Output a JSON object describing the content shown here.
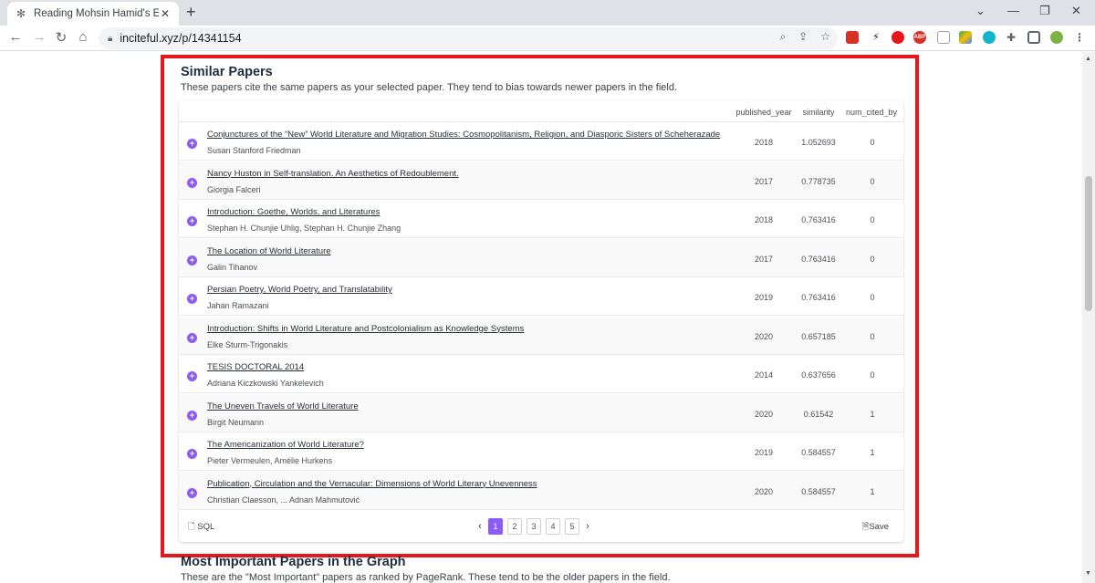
{
  "browser": {
    "tab_title": "Reading Mohsin Hamid's Exit We",
    "tab_close": "✕",
    "new_tab": "+",
    "url": "inciteful.xyz/p/14341154",
    "nav": {
      "back": "←",
      "forward": "→",
      "reload": "↻",
      "home": "⌂"
    },
    "window": {
      "dropdown": "⌄",
      "minimize": "—",
      "restore": "❐",
      "close": "✕"
    }
  },
  "similar": {
    "title": "Similar Papers",
    "description": "These papers cite the same papers as your selected paper. They tend to bias towards newer papers in the field.",
    "columns": {
      "year": "published_year",
      "similarity": "similarity",
      "cited": "num_cited_by"
    },
    "rows": [
      {
        "title": "Conjunctures of the “New” World Literature and Migration Studies: Cosmopolitanism, Religion, and Diasporic Sisters of Scheherazade",
        "authors": "Susan Stanford Friedman",
        "year": "2018",
        "similarity": "1.052693",
        "cited": "0"
      },
      {
        "title": "Nancy Huston in Self-translation. An Aesthetics of Redoublement.",
        "authors": "Giorgia Falceri",
        "year": "2017",
        "similarity": "0.778735",
        "cited": "0"
      },
      {
        "title": "Introduction: Goethe, Worlds, and Literatures",
        "authors": "Stephan H. Chunjie Uhlig, Stephan H. Chunjie Zhang",
        "year": "2018",
        "similarity": "0.763416",
        "cited": "0"
      },
      {
        "title": "The Location of World Literature",
        "authors": "Galin Tihanov",
        "year": "2017",
        "similarity": "0.763416",
        "cited": "0"
      },
      {
        "title": "Persian Poetry, World Poetry, and Translatability",
        "authors": "Jahan Ramazani",
        "year": "2019",
        "similarity": "0.763416",
        "cited": "0"
      },
      {
        "title": "Introduction: Shifts in World Literature and Postcolonialism as Knowledge Systems",
        "authors": "Elke Sturm-Trigonakis",
        "year": "2020",
        "similarity": "0.657185",
        "cited": "0"
      },
      {
        "title": "TESIS DOCTORAL 2014",
        "authors": "Adriana Kiczkowski Yankelevich",
        "year": "2014",
        "similarity": "0.637656",
        "cited": "0"
      },
      {
        "title": "The Uneven Travels of World Literature",
        "authors": "Birgit Neumann",
        "year": "2020",
        "similarity": "0.61542",
        "cited": "1"
      },
      {
        "title": "The Americanization of World Literature?",
        "authors": "Pieter Vermeulen, Amélie Hurkens",
        "year": "2019",
        "similarity": "0.584557",
        "cited": "1"
      },
      {
        "title": "Publication, Circulation and the Vernacular: Dimensions of World Literary Unevenness",
        "authors": "Christian Claesson, ... Adnan Mahmutović",
        "year": "2020",
        "similarity": "0.584557",
        "cited": "1"
      }
    ],
    "sql_label": "SQL",
    "save_label": "Save",
    "pages": [
      "1",
      "2",
      "3",
      "4",
      "5"
    ],
    "current_page": "1",
    "prev_label": "‹",
    "next_label": "›"
  },
  "important": {
    "title": "Most Important Papers in the Graph",
    "description": "These are the \"Most Important\" papers as ranked by PageRank. These tend to be the older papers in the field."
  },
  "colors": {
    "accent": "#8b5cf6",
    "highlight": "#e8151b"
  }
}
